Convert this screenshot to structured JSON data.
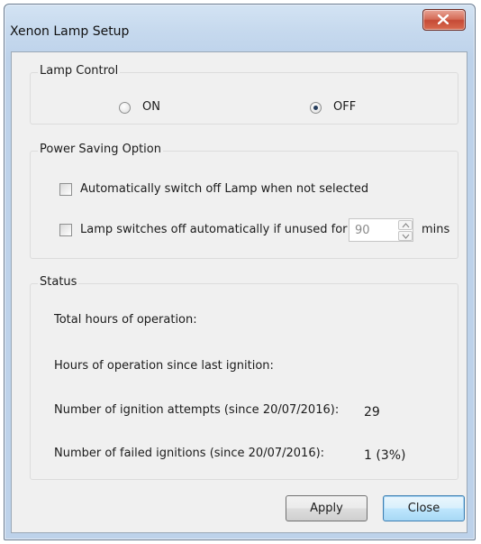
{
  "window": {
    "title": "Xenon Lamp Setup"
  },
  "lamp_control": {
    "label": "Lamp Control",
    "on_label": "ON",
    "off_label": "OFF",
    "selected": "OFF"
  },
  "power_saving": {
    "label": "Power Saving Option",
    "auto_off_unselected_label": "Automatically switch off Lamp when not selected",
    "auto_off_unused_label": "Lamp switches off automatically if unused for",
    "unused_minutes": "90",
    "minutes_unit": "mins"
  },
  "status": {
    "label": "Status",
    "total_hours_label": "Total hours of operation:",
    "hours_since_ignition_label": "Hours of operation since last ignition:",
    "ignition_attempts_label": "Number of ignition attempts (since 20/07/2016):",
    "ignition_attempts_value": "29",
    "failed_ignitions_label": "Number of failed ignitions (since 20/07/2016):",
    "failed_ignitions_value": "1 (3%)"
  },
  "buttons": {
    "apply": "Apply",
    "close": "Close"
  },
  "colors": {
    "titlebar": "#c6d9ee",
    "close_button": "#c54a35",
    "default_button_border": "#3c7fb1"
  }
}
